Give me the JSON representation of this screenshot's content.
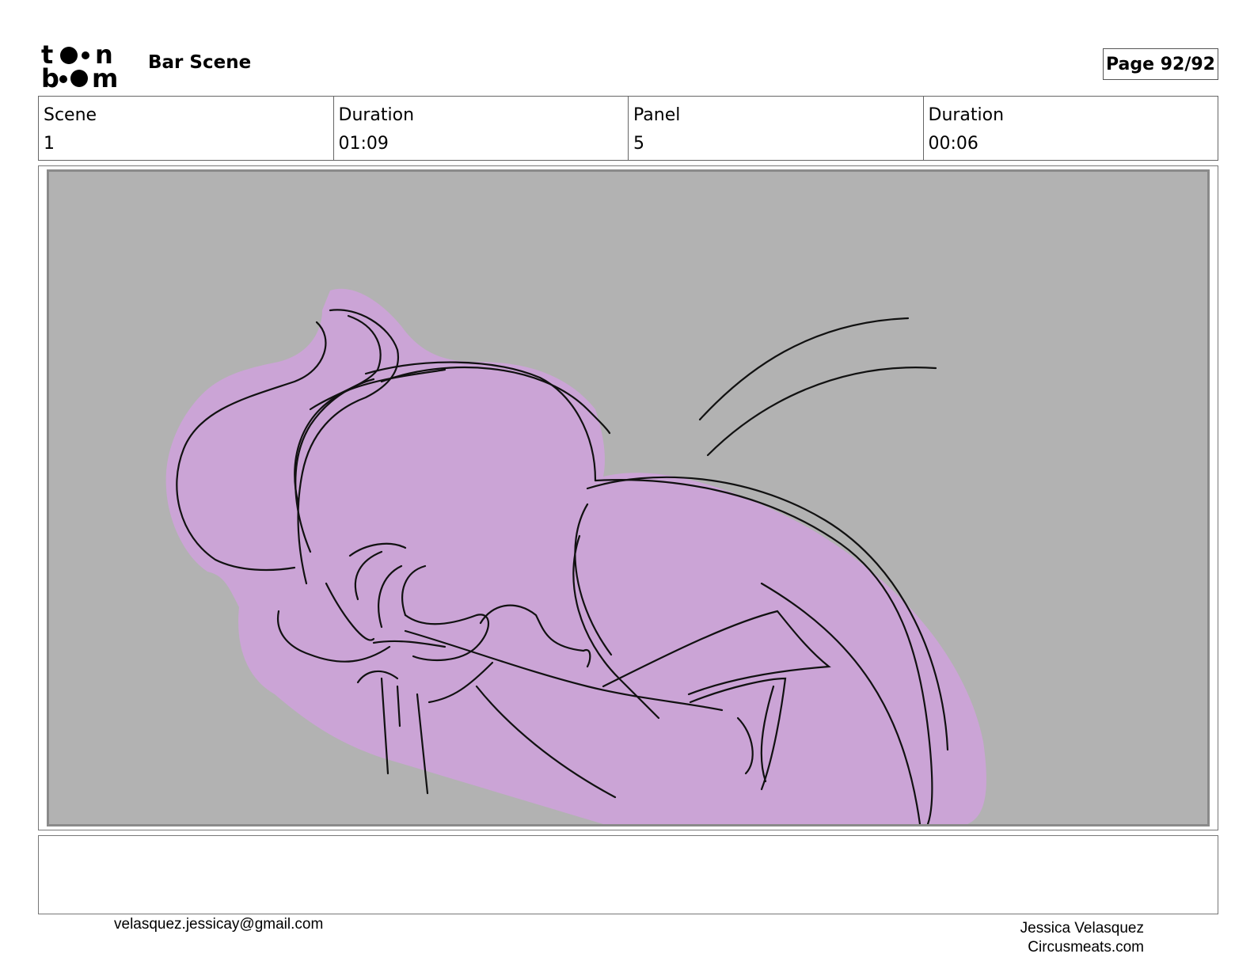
{
  "header": {
    "logo_text": "toon boom",
    "project_title": "Bar Scene",
    "page_label": "Page 92/92"
  },
  "info": [
    {
      "label": "Scene",
      "value": "1"
    },
    {
      "label": "Duration",
      "value": "01:09"
    },
    {
      "label": "Panel",
      "value": "5"
    },
    {
      "label": "Duration",
      "value": "00:06"
    }
  ],
  "panel": {
    "background_color": "#b2b2b2",
    "fill_color": "#cba4d6",
    "line_color": "#111111"
  },
  "notes": {
    "text": ""
  },
  "footer": {
    "email": "velasquez.jessicay@gmail.com",
    "author": "Jessica Velasquez",
    "website": "Circusmeats.com"
  }
}
